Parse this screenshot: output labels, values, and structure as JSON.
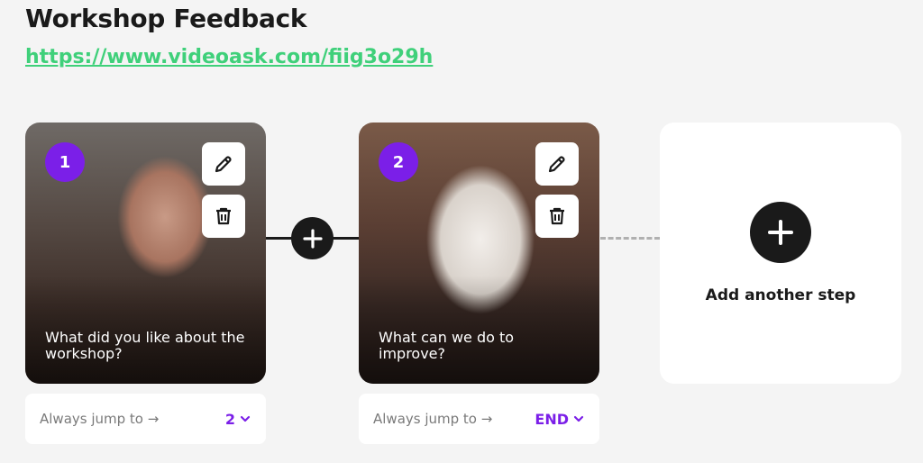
{
  "page": {
    "title": "Workshop Feedback",
    "url": "https://www.videoask.com/fiig3o29h"
  },
  "steps": [
    {
      "number": "1",
      "caption": "What did you like about the workshop?",
      "jump_label": "Always jump to →",
      "jump_value": "2"
    },
    {
      "number": "2",
      "caption": "What can we do to improve?",
      "jump_label": "Always jump to →",
      "jump_value": "END"
    }
  ],
  "add_step": {
    "label": "Add another step"
  },
  "colors": {
    "accent": "#7b1fe8",
    "link": "#3fd07a",
    "dark": "#1a1a1a",
    "background": "#f4f4f4"
  },
  "icons": [
    "pencil-icon",
    "trash-icon",
    "plus-icon",
    "chevron-down-icon"
  ]
}
